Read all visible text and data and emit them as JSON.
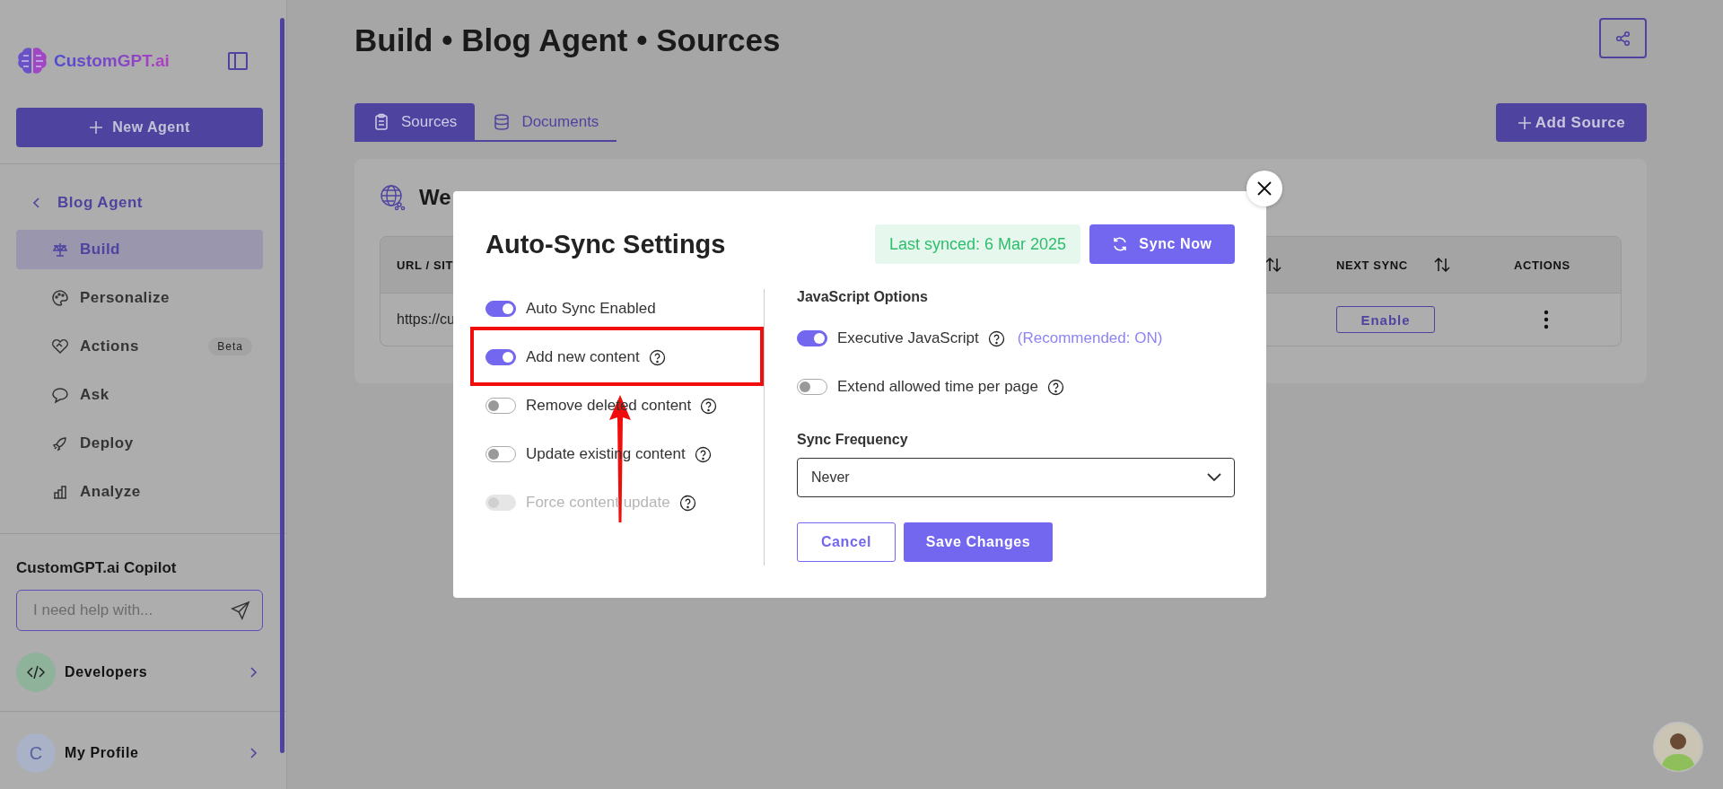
{
  "sidebar": {
    "logo": "CustomGPT.ai",
    "new_agent_button": "New Agent",
    "back_link": "Blog Agent",
    "items": [
      {
        "kind": "build",
        "label": "Build",
        "selected": true
      },
      {
        "kind": "palette",
        "label": "Personalize",
        "selected": false
      },
      {
        "kind": "actions",
        "label": "Actions",
        "selected": false,
        "badge": "Beta"
      },
      {
        "kind": "chat",
        "label": "Ask",
        "selected": false
      },
      {
        "kind": "rocket",
        "label": "Deploy",
        "selected": false
      },
      {
        "kind": "chart",
        "label": "Analyze",
        "selected": false
      }
    ],
    "copilot": {
      "title": "CustomGPT.ai Copilot",
      "placeholder": "I need help with..."
    },
    "developers": "Developers",
    "profile": {
      "initial": "C",
      "name": "My Profile"
    }
  },
  "page": {
    "title": "Build • Blog Agent • Sources",
    "tabs": [
      {
        "kind": "clipboard",
        "label": "Sources",
        "selected": true
      },
      {
        "kind": "database",
        "label": "Documents",
        "selected": false
      }
    ],
    "add_source_button": "Add Source",
    "card": {
      "title": "We",
      "columns": [
        {
          "label": "URL / SIT",
          "sortable": false
        },
        {
          "sortable": true
        },
        {
          "label": "NEXT SYNC",
          "sortable": true
        },
        {
          "label": "ACTIONS",
          "sortable": false
        }
      ],
      "rows": [
        {
          "url": "https://cu",
          "next_sync_button": "Enable"
        }
      ]
    }
  },
  "modal": {
    "title": "Auto-Sync Settings",
    "last_synced": "Last synced: 6 Mar 2025",
    "sync_button": "Sync Now",
    "options": [
      {
        "label": "Auto Sync Enabled",
        "on": true,
        "disabled": false,
        "help": false,
        "highlighted": false
      },
      {
        "label": "Add new content",
        "on": true,
        "disabled": false,
        "help": true,
        "highlighted": true
      },
      {
        "label": "Remove deleted content",
        "on": false,
        "disabled": false,
        "help": true,
        "highlighted": false
      },
      {
        "label": "Update existing content",
        "on": false,
        "disabled": false,
        "help": true,
        "highlighted": false
      },
      {
        "label": "Force content update",
        "on": false,
        "disabled": true,
        "help": true,
        "highlighted": false
      }
    ],
    "js_title": "JavaScript Options",
    "js_options": [
      {
        "label": "Executive JavaScript",
        "on": true,
        "help": true,
        "note": "(Recommended: ON)"
      },
      {
        "label": "Extend allowed time per page",
        "on": false,
        "help": true
      }
    ],
    "frequency": {
      "label": "Sync Frequency",
      "value": "Never"
    },
    "cancel_button": "Cancel",
    "save_button": "Save Changes"
  }
}
